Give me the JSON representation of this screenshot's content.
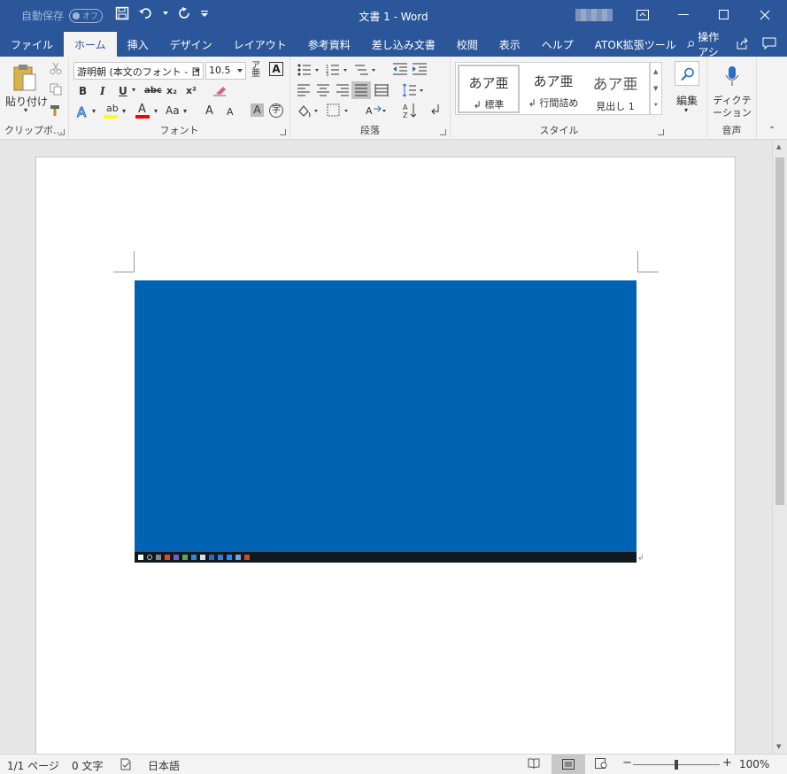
{
  "titlebar": {
    "autosave_label": "自動保存",
    "autosave_state": "オフ",
    "doc_title": "文書 1 - Word"
  },
  "tabs": [
    "ファイル",
    "ホーム",
    "挿入",
    "デザイン",
    "レイアウト",
    "参考資料",
    "差し込み文書",
    "校閲",
    "表示",
    "ヘルプ",
    "ATOK拡張ツール"
  ],
  "tell_me": "操作アシ",
  "ribbon": {
    "clipboard": {
      "paste": "貼り付け",
      "label": "クリップボ…"
    },
    "font": {
      "name": "游明朝 (本文のフォント - 日",
      "size": "10.5",
      "label": "フォント",
      "bold": "B",
      "italic": "I",
      "underline": "U",
      "strike": "abc",
      "sub": "x₂",
      "sup": "x²",
      "case": "Aa",
      "grow": "A",
      "shrink": "A",
      "shade": "A",
      "enclose": "字"
    },
    "paragraph": {
      "label": "段落"
    },
    "styles": {
      "label": "スタイル",
      "items": [
        {
          "preview": "あア亜",
          "name": "↲ 標準"
        },
        {
          "preview": "あア亜",
          "name": "↲ 行間詰め"
        },
        {
          "preview": "あア亜",
          "name": "見出し 1"
        }
      ]
    },
    "editing": {
      "label": "編集"
    },
    "voice": {
      "button": "ディクテーション",
      "label": "音声"
    }
  },
  "status": {
    "page": "1/1 ページ",
    "words": "0 文字",
    "language": "日本語",
    "zoom": "100%"
  },
  "colors": {
    "brand": "#2b579a",
    "image_bg": "#0063b1",
    "highlight": "#ffff00",
    "font_color": "#ff0000"
  }
}
